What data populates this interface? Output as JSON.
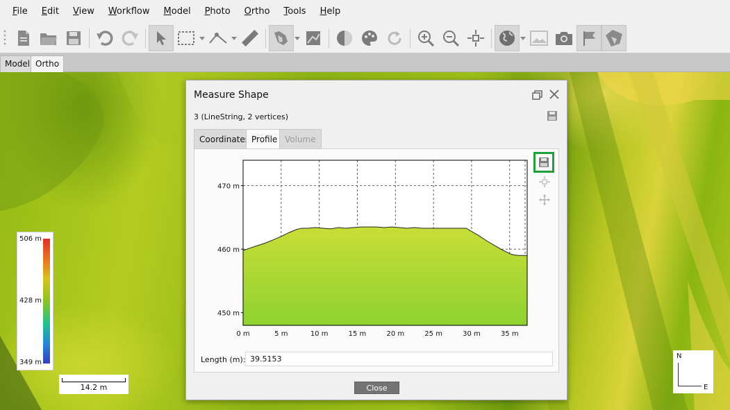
{
  "menu": [
    {
      "pre": "",
      "ul": "F",
      "post": "ile"
    },
    {
      "pre": "",
      "ul": "E",
      "post": "dit"
    },
    {
      "pre": "",
      "ul": "V",
      "post": "iew"
    },
    {
      "pre": "",
      "ul": "W",
      "post": "orkflow"
    },
    {
      "pre": "",
      "ul": "M",
      "post": "odel"
    },
    {
      "pre": "",
      "ul": "P",
      "post": "hoto"
    },
    {
      "pre": "",
      "ul": "O",
      "post": "rtho"
    },
    {
      "pre": "",
      "ul": "T",
      "post": "ools"
    },
    {
      "pre": "",
      "ul": "H",
      "post": "elp"
    }
  ],
  "view_tabs": {
    "model": "Model",
    "ortho": "Ortho"
  },
  "legend": {
    "max": "506 m",
    "mid": "428 m",
    "min": "349 m"
  },
  "scale": {
    "label": "14.2 m"
  },
  "compass": {
    "north": "N",
    "east": "E"
  },
  "dialog": {
    "title": "Measure Shape",
    "info": "3 (LineString, 2 vertices)",
    "tabs": {
      "coordinates": "Coordinates",
      "profile": "Profile",
      "volume": "Volume"
    },
    "length_label": "Length (m):",
    "length_value": "39.5153",
    "close_label": "Close"
  },
  "chart_data": {
    "type": "area",
    "title": "",
    "xlabel": "",
    "ylabel": "",
    "xlim": [
      0,
      37.3
    ],
    "ylim": [
      448,
      474
    ],
    "x_ticks": [
      0,
      5,
      10,
      15,
      20,
      25,
      30,
      35
    ],
    "x_tick_labels": [
      "0 m",
      "5 m",
      "10 m",
      "15 m",
      "20 m",
      "25 m",
      "30 m",
      "35 m"
    ],
    "y_ticks": [
      450,
      460,
      470
    ],
    "y_tick_labels": [
      "450 m",
      "460 m",
      "470 m"
    ],
    "grid": true,
    "series": [
      {
        "x": [
          0,
          1,
          2,
          3,
          4,
          5,
          6,
          7,
          7.7,
          8.5,
          9.5,
          10.5,
          11.5,
          12.5,
          13.5,
          14.5,
          15.5,
          16.5,
          17.5,
          18.5,
          19.5,
          20.5,
          21.5,
          22.5,
          23.5,
          24.5,
          25.5,
          26.5,
          27.5,
          28.5,
          29.3,
          30,
          31,
          32,
          33,
          34,
          35,
          35.5,
          36.2,
          37.3
        ],
        "y": [
          459.8,
          460.2,
          460.6,
          461.0,
          461.5,
          462.0,
          462.6,
          463.1,
          463.3,
          463.3,
          463.4,
          463.3,
          463.2,
          463.4,
          463.3,
          463.4,
          463.5,
          463.5,
          463.5,
          463.4,
          463.5,
          463.4,
          463.3,
          463.4,
          463.3,
          463.3,
          463.3,
          463.3,
          463.3,
          463.3,
          463.3,
          462.8,
          462.1,
          461.3,
          460.6,
          459.9,
          459.3,
          459.1,
          459.0,
          459.0
        ]
      }
    ]
  }
}
